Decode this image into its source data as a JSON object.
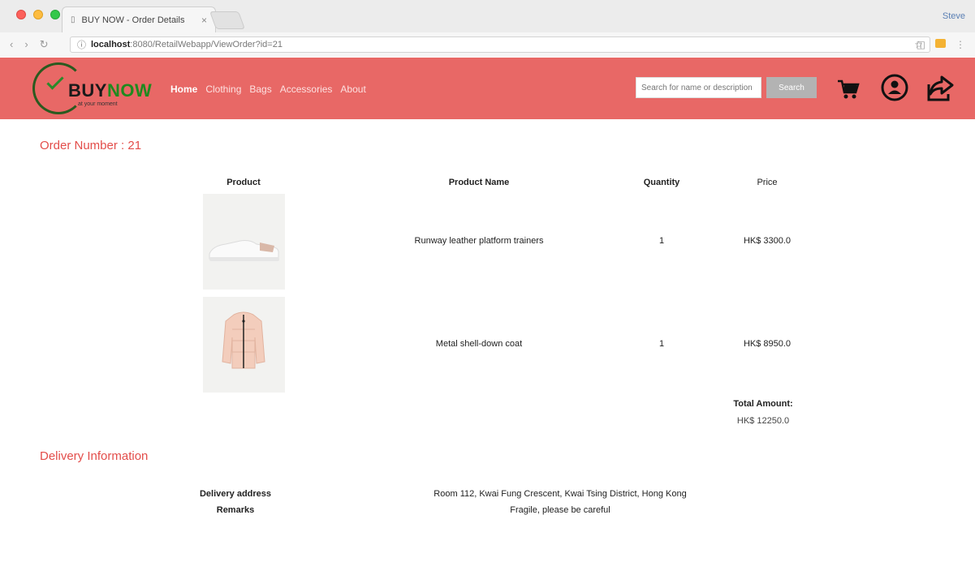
{
  "browser": {
    "tab_title": "BUY NOW - Order Details",
    "tab_close": "×",
    "profile": "Steve",
    "url_host": "localhost",
    "url_path": ":8080/RetailWebapp/ViewOrder?id=21"
  },
  "header": {
    "logo_buy": "BUY",
    "logo_now": "NOW",
    "logo_tagline": "at your moment",
    "nav": [
      {
        "label": "Home"
      },
      {
        "label": "Clothing"
      },
      {
        "label": "Bags"
      },
      {
        "label": "Accessories"
      },
      {
        "label": "About"
      }
    ],
    "search_placeholder": "Search for name or description",
    "search_button": "Search"
  },
  "order": {
    "title": "Order Number : 21",
    "columns": {
      "product": "Product",
      "name": "Product Name",
      "quantity": "Quantity",
      "price": "Price"
    },
    "items": [
      {
        "name": "Runway leather platform trainers",
        "quantity": "1",
        "price": "HK$ 3300.0",
        "image": "sneaker"
      },
      {
        "name": "Metal shell-down coat",
        "quantity": "1",
        "price": "HK$ 8950.0",
        "image": "puffer-coat"
      }
    ],
    "total_label": "Total Amount:",
    "total_value": "HK$ 12250.0"
  },
  "delivery": {
    "title": "Delivery Information",
    "address_label": "Delivery address",
    "address_value": "Room 112, Kwai Fung Crescent, Kwai Tsing District, Hong Kong",
    "remarks_label": "Remarks",
    "remarks_value": "Fragile, please be careful"
  },
  "colors": {
    "header_bg": "#e86866",
    "accent_text": "#e34d4a",
    "logo_green": "#1f8a1f"
  }
}
